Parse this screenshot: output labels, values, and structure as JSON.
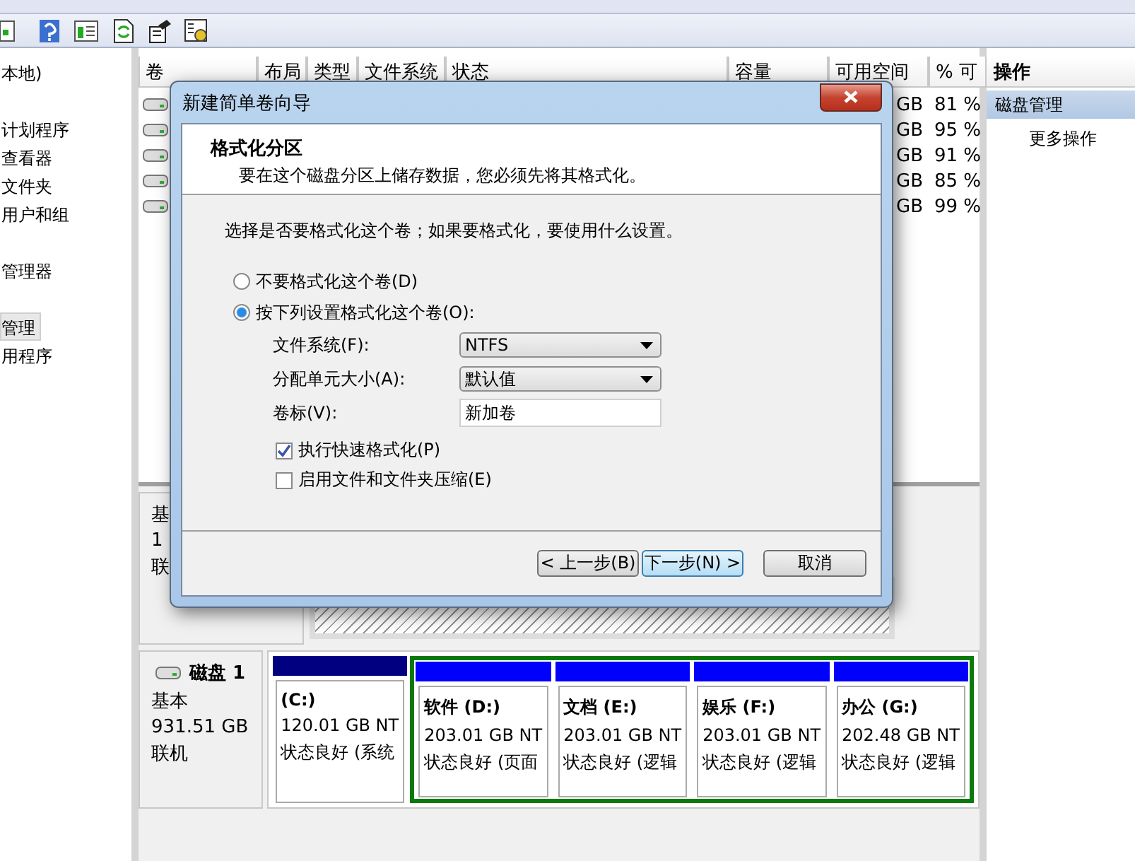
{
  "tree": {
    "items": [
      {
        "label": "本地)",
        "selected": false
      },
      {
        "label": "计划程序",
        "selected": false
      },
      {
        "label": "查看器",
        "selected": false
      },
      {
        "label": "文件夹",
        "selected": false
      },
      {
        "label": "用户和组",
        "selected": false
      },
      {
        "label": "管理器",
        "selected": false
      },
      {
        "label": "管理",
        "selected": true
      },
      {
        "label": "用程序",
        "selected": false
      }
    ]
  },
  "table": {
    "columns": [
      "卷",
      "布局",
      "类型",
      "文件系统",
      "状态",
      "容量",
      "可用空间",
      "% 可"
    ],
    "rows": [
      {
        "free": "GB",
        "percent": "81 %"
      },
      {
        "free": "GB",
        "percent": "95 %"
      },
      {
        "free": "GB",
        "percent": "91 %"
      },
      {
        "free": "GB",
        "percent": "85 %"
      },
      {
        "free": "GB",
        "percent": "99 %"
      }
    ]
  },
  "disks": [
    {
      "lines": [
        "基",
        "1",
        "联"
      ]
    },
    {
      "name": "磁盘 1",
      "lines": [
        "基本",
        "931.51 GB",
        "联机"
      ],
      "partitions": [
        {
          "kind": "primary",
          "color": "#000080",
          "name": "(C:)",
          "size": "120.01 GB NT",
          "status": "状态良好 (系统"
        },
        {
          "kind": "logical",
          "color": "#0000ff",
          "name": "软件  (D:)",
          "size": "203.01 GB NT",
          "status": "状态良好 (页面"
        },
        {
          "kind": "logical",
          "color": "#0000ff",
          "name": "文档  (E:)",
          "size": "203.01 GB NT",
          "status": "状态良好 (逻辑"
        },
        {
          "kind": "logical",
          "color": "#0000ff",
          "name": "娱乐  (F:)",
          "size": "203.01 GB NT",
          "status": "状态良好 (逻辑"
        },
        {
          "kind": "logical",
          "color": "#0000ff",
          "name": "办公  (G:)",
          "size": "202.48 GB NT",
          "status": "状态良好 (逻辑"
        }
      ]
    }
  ],
  "actions": {
    "title": "操作",
    "items": [
      {
        "label": "磁盘管理",
        "kind": "header"
      },
      {
        "label": "更多操作",
        "kind": "item"
      }
    ]
  },
  "dialog": {
    "title": "新建简单卷向导",
    "heading": "格式化分区",
    "subheading": "要在这个磁盘分区上储存数据，您必须先将其格式化。",
    "prompt": "选择是否要格式化这个卷；如果要格式化，要使用什么设置。",
    "options": [
      {
        "label": "不要格式化这个卷(D)",
        "selected": false
      },
      {
        "label": "按下列设置格式化这个卷(O):",
        "selected": true
      }
    ],
    "fields": [
      {
        "kind": "select",
        "label": "文件系统(F):",
        "value": "NTFS"
      },
      {
        "kind": "select",
        "label": "分配单元大小(A):",
        "value": "默认值"
      },
      {
        "kind": "text",
        "label": "卷标(V):",
        "value": "新加卷"
      }
    ],
    "checkboxes": [
      {
        "label": "执行快速格式化(P)",
        "checked": true
      },
      {
        "label": "启用文件和文件夹压缩(E)",
        "checked": false
      }
    ],
    "buttons": [
      {
        "label": "< 上一步(B)",
        "kind": "back"
      },
      {
        "label": "下一步(N) >",
        "kind": "next"
      },
      {
        "label": "取消",
        "kind": "cancel"
      }
    ]
  }
}
